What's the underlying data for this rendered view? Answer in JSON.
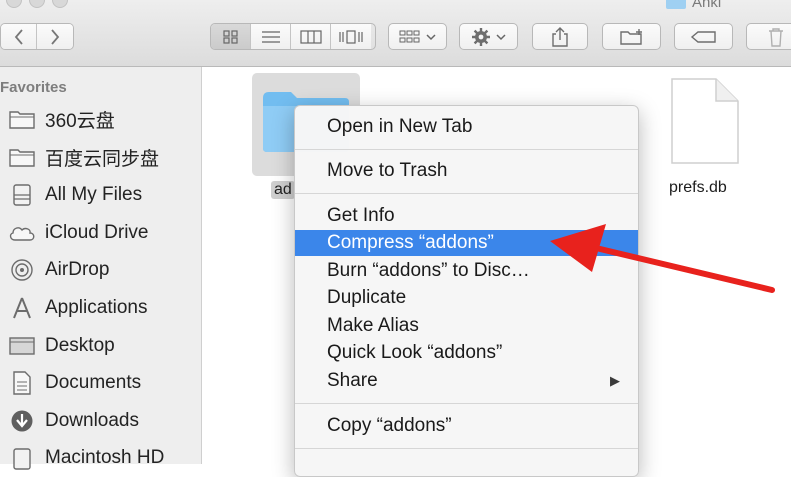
{
  "window": {
    "title": "Anki"
  },
  "sidebar": {
    "heading": "Favorites",
    "items": [
      {
        "label": "360云盘",
        "icon": "folder-icon"
      },
      {
        "label": "百度云同步盘",
        "icon": "folder-icon"
      },
      {
        "label": "All My Files",
        "icon": "all-files-icon"
      },
      {
        "label": "iCloud Drive",
        "icon": "cloud-icon"
      },
      {
        "label": "AirDrop",
        "icon": "airdrop-icon"
      },
      {
        "label": "Applications",
        "icon": "applications-icon"
      },
      {
        "label": "Desktop",
        "icon": "desktop-icon"
      },
      {
        "label": "Documents",
        "icon": "documents-icon"
      },
      {
        "label": "Downloads",
        "icon": "downloads-icon"
      },
      {
        "label": "Macintosh HD",
        "icon": "disk-icon"
      }
    ]
  },
  "files": [
    {
      "name": "ad",
      "kind": "folder",
      "selected": true
    },
    {
      "name": "prefs.db",
      "kind": "document"
    }
  ],
  "context_menu": {
    "items": [
      {
        "label": "Open in New Tab"
      },
      {
        "label": "Move to Trash"
      },
      {
        "label": "Get Info"
      },
      {
        "label": "Compress “addons”",
        "highlighted": true
      },
      {
        "label": "Burn “addons” to Disc…"
      },
      {
        "label": "Duplicate"
      },
      {
        "label": "Make Alias"
      },
      {
        "label": "Quick Look “addons”"
      },
      {
        "label": "Share",
        "submenu": true
      },
      {
        "label": "Copy “addons”"
      }
    ],
    "submenu_glyph": "▶"
  },
  "colors": {
    "highlight": "#3b86ea",
    "annotation_arrow": "#e8221d",
    "folder": "#7cc2f1"
  }
}
